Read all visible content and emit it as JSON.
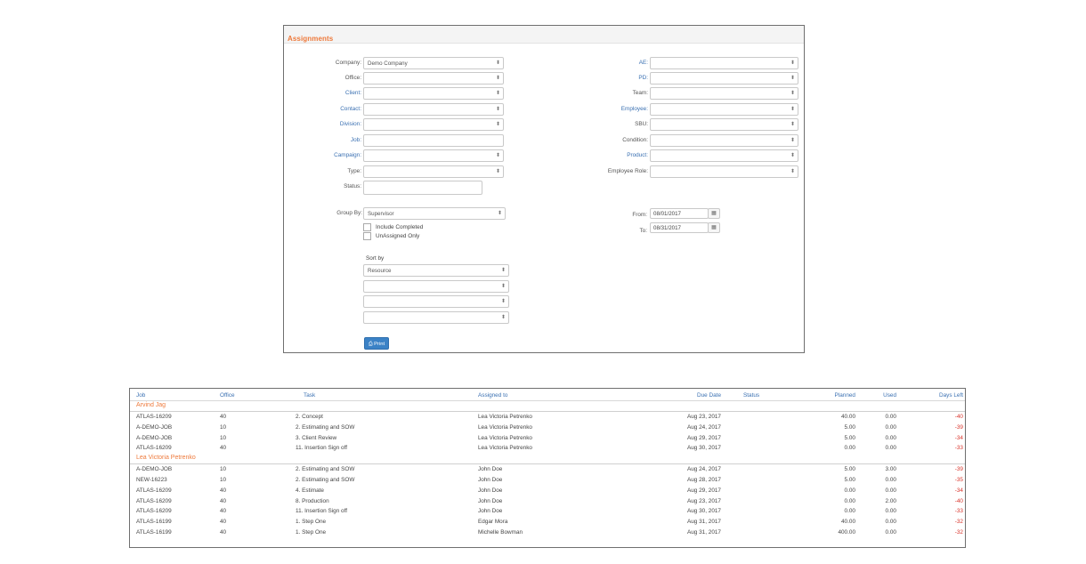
{
  "panel": {
    "title": "Assignments",
    "left_fields": [
      {
        "label": "Company:",
        "value": "Demo Company",
        "link": false,
        "type": "select"
      },
      {
        "label": "Office:",
        "value": "",
        "link": false,
        "type": "select"
      },
      {
        "label": "Client:",
        "value": "",
        "link": true,
        "type": "select"
      },
      {
        "label": "Contact:",
        "value": "",
        "link": true,
        "type": "select"
      },
      {
        "label": "Division:",
        "value": "",
        "link": true,
        "type": "select"
      },
      {
        "label": "Job:",
        "value": "",
        "link": true,
        "type": "text"
      },
      {
        "label": "Campaign:",
        "value": "",
        "link": true,
        "type": "select"
      },
      {
        "label": "Type:",
        "value": "",
        "link": false,
        "type": "select"
      },
      {
        "label": "Status:",
        "value": "",
        "link": false,
        "type": "listbox"
      }
    ],
    "right_fields": [
      {
        "label": "AE:",
        "value": "",
        "link": true
      },
      {
        "label": "PD:",
        "value": "",
        "link": true
      },
      {
        "label": "Team:",
        "value": "",
        "link": false
      },
      {
        "label": "Employee:",
        "value": "",
        "link": true
      },
      {
        "label": "SBU:",
        "value": "",
        "link": false
      },
      {
        "label": "Condition:",
        "value": "",
        "link": false
      },
      {
        "label": "Product:",
        "value": "",
        "link": true
      },
      {
        "label": "Employee Role:",
        "value": "",
        "link": false
      }
    ],
    "group_by": {
      "label": "Group By:",
      "value": "Supervisor"
    },
    "include_completed": "Include Completed",
    "unassigned_only": "UnAssigned Only",
    "from": {
      "label": "From:",
      "value": "08/01/2017"
    },
    "to": {
      "label": "To:",
      "value": "08/31/2017"
    },
    "calendar_icon": "calendar-icon",
    "sort_by": {
      "label": "Sort by",
      "values": [
        "Resource",
        "",
        "",
        ""
      ]
    },
    "print_label": "Print",
    "print_icon": "printer-icon",
    "select_arrow": "⬍"
  },
  "results": {
    "columns": [
      "Job",
      "Office",
      "Task",
      "Assigned to",
      "Due Date",
      "Status",
      "Planned",
      "Used",
      "Days Left"
    ],
    "groups": [
      {
        "name": "Arvind Jag",
        "rows": [
          {
            "job": "ATLAS-16209",
            "office": "40",
            "task": "2. Concept",
            "assigned": "Lea Victoria Petrenko",
            "due": "Aug 23, 2017",
            "status": "",
            "planned": "40.00",
            "used": "0.00",
            "days_left": "-40"
          },
          {
            "job": "A-DEMO-JOB",
            "office": "10",
            "task": "2. Estimating and SOW",
            "assigned": "Lea Victoria Petrenko",
            "due": "Aug 24, 2017",
            "status": "",
            "planned": "5.00",
            "used": "0.00",
            "days_left": "-39"
          },
          {
            "job": "A-DEMO-JOB",
            "office": "10",
            "task": "3. Client Review",
            "assigned": "Lea Victoria Petrenko",
            "due": "Aug 29, 2017",
            "status": "",
            "planned": "5.00",
            "used": "0.00",
            "days_left": "-34"
          },
          {
            "job": "ATLAS-16209",
            "office": "40",
            "task": "11. Insertion Sign off",
            "assigned": "Lea Victoria Petrenko",
            "due": "Aug 30, 2017",
            "status": "",
            "planned": "0.00",
            "used": "0.00",
            "days_left": "-33"
          }
        ]
      },
      {
        "name": "Lea Victoria Petrenko",
        "rows": [
          {
            "job": "A-DEMO-JOB",
            "office": "10",
            "task": "2. Estimating and SOW",
            "assigned": "John Doe",
            "due": "Aug 24, 2017",
            "status": "",
            "planned": "5.00",
            "used": "3.00",
            "days_left": "-39"
          },
          {
            "job": "NEW-16223",
            "office": "10",
            "task": "2. Estimating and SOW",
            "assigned": "John Doe",
            "due": "Aug 28, 2017",
            "status": "",
            "planned": "5.00",
            "used": "0.00",
            "days_left": "-35"
          },
          {
            "job": "ATLAS-16209",
            "office": "40",
            "task": "4. Estimate",
            "assigned": "John Doe",
            "due": "Aug 29, 2017",
            "status": "",
            "planned": "0.00",
            "used": "0.00",
            "days_left": "-34"
          },
          {
            "job": "ATLAS-16209",
            "office": "40",
            "task": "8. Production",
            "assigned": "John Doe",
            "due": "Aug 23, 2017",
            "status": "",
            "planned": "0.00",
            "used": "2.00",
            "days_left": "-40"
          },
          {
            "job": "ATLAS-16209",
            "office": "40",
            "task": "11. Insertion Sign off",
            "assigned": "John Doe",
            "due": "Aug 30, 2017",
            "status": "",
            "planned": "0.00",
            "used": "0.00",
            "days_left": "-33"
          },
          {
            "job": "ATLAS-16199",
            "office": "40",
            "task": "1. Step One",
            "assigned": "Edgar Mora",
            "due": "Aug 31, 2017",
            "status": "",
            "planned": "40.00",
            "used": "0.00",
            "days_left": "-32"
          },
          {
            "job": "ATLAS-16199",
            "office": "40",
            "task": "1. Step One",
            "assigned": "Michelle Bowman",
            "due": "Aug 31, 2017",
            "status": "",
            "planned": "400.00",
            "used": "0.00",
            "days_left": "-32"
          }
        ]
      }
    ]
  },
  "colors": {
    "accent_orange": "#ee7a3c",
    "link_blue": "#3a70b2",
    "negative_red": "#d9342b",
    "button_blue": "#3b82c6"
  }
}
